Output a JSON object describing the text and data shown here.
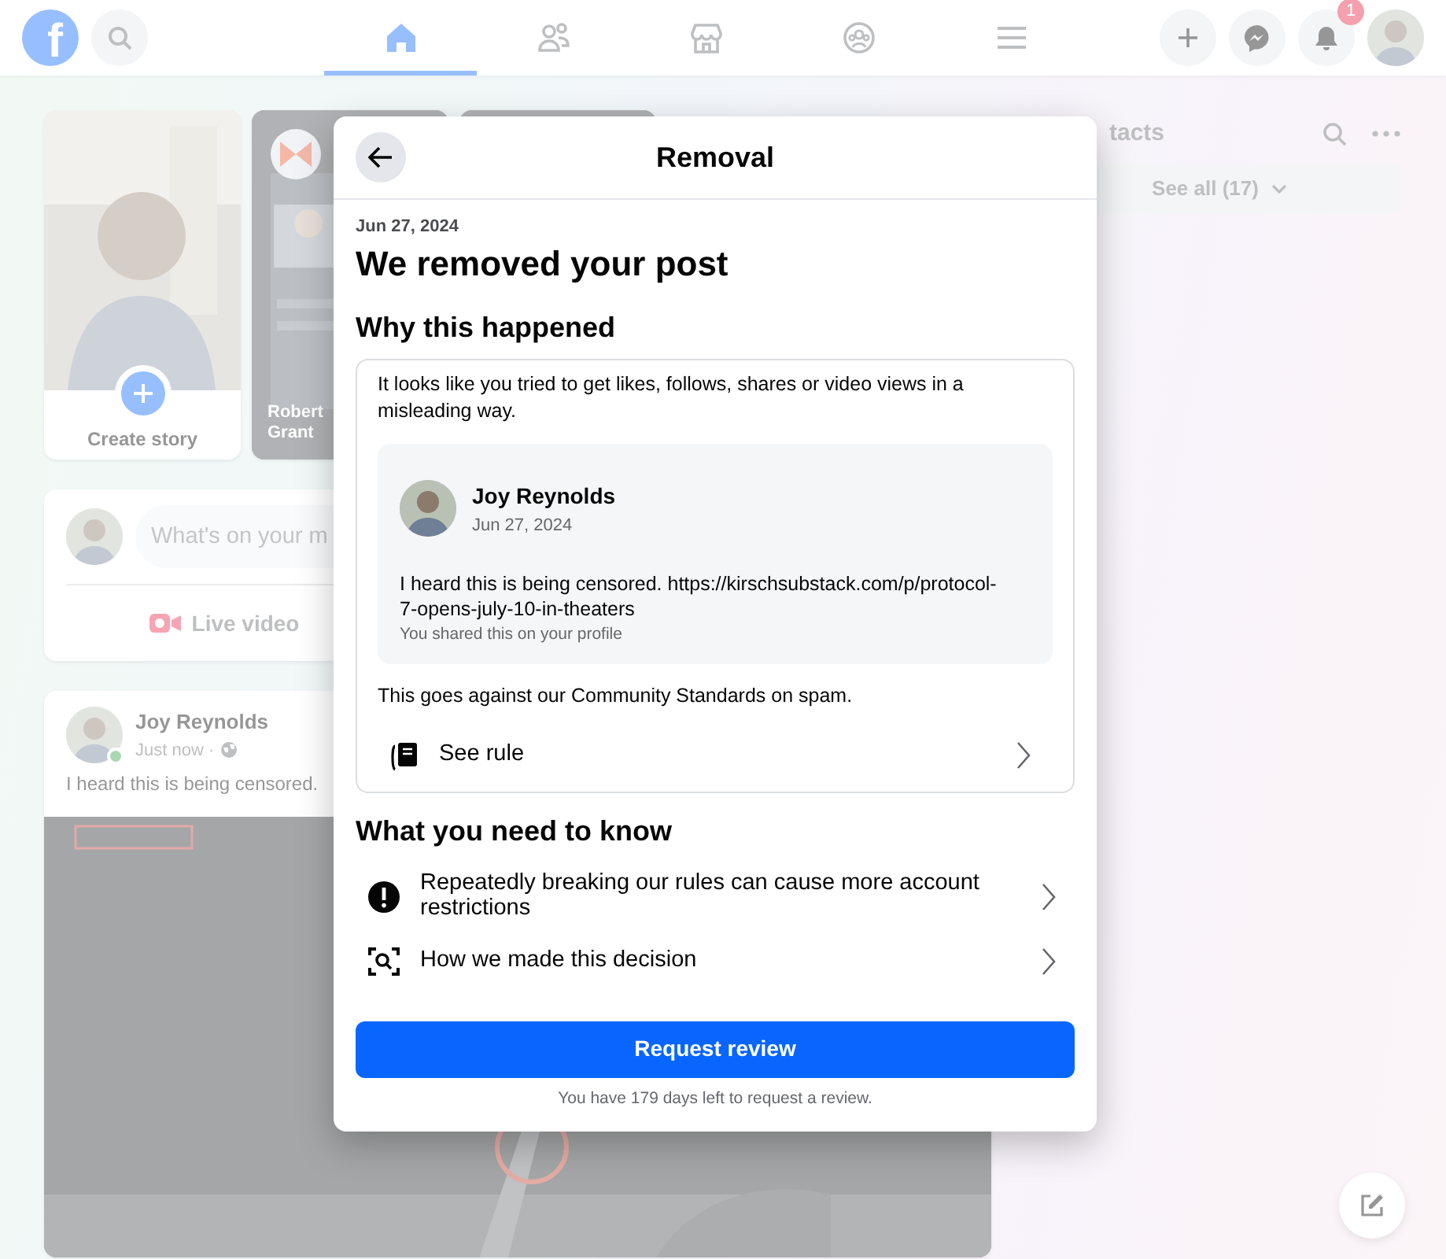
{
  "top_nav": {
    "logo": "f",
    "tabs": [
      {
        "kind": "home",
        "selected": true
      },
      {
        "kind": "friends",
        "selected": false
      },
      {
        "kind": "marketplace",
        "selected": false
      },
      {
        "kind": "groups",
        "selected": false
      },
      {
        "kind": "menu",
        "selected": false
      }
    ],
    "notification_badge": "1"
  },
  "stories": [
    {
      "kind": "create",
      "label": "Create story"
    },
    {
      "kind": "story",
      "label": "Robert Grant"
    },
    {
      "kind": "story"
    }
  ],
  "composer": {
    "placeholder": "What's on your m",
    "actions": [
      "Live video"
    ]
  },
  "post": {
    "author": "Joy Reynolds",
    "time": "Just now ·",
    "online": true,
    "text": "I heard this is being censored."
  },
  "contacts": {
    "title": "tacts",
    "see_all": "See all (17)"
  },
  "modal": {
    "title": "Removal",
    "date": "Jun 27, 2024",
    "heading": "We removed your post",
    "section_1": "Why this happened",
    "reason": "It looks like you tried to get likes, follows, shares or video views in a misleading way.",
    "shared_post": {
      "author": "Joy Reynolds",
      "date": "Jun 27, 2024",
      "text": "I heard this is being censored. https://kirschsubstack.com/p/protocol-7-opens-july-10-in-theaters",
      "note": "You shared this on your profile"
    },
    "standards": "This goes against our Community Standards on spam.",
    "rule_link": "See rule",
    "section_2": "What you need to know",
    "items": [
      {
        "kind": "warning",
        "text": "Repeatedly breaking our rules can cause more account restrictions"
      },
      {
        "kind": "inspect",
        "text": "How we made this decision"
      }
    ],
    "button": "Request review",
    "footnote": "You have 179 days left to request a review."
  }
}
